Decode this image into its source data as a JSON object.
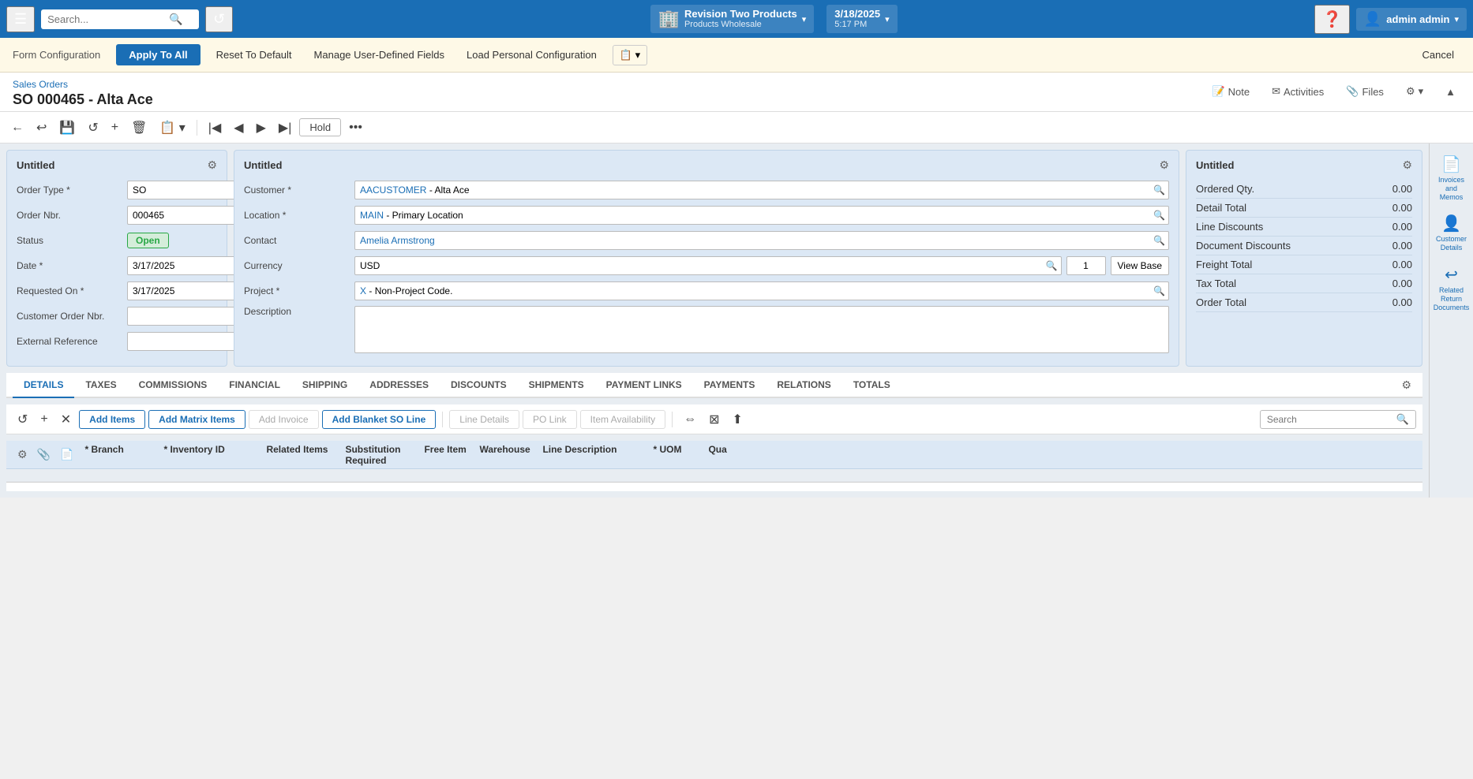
{
  "topNav": {
    "searchPlaceholder": "Search...",
    "company": {
      "name": "Revision Two Products",
      "sub": "Products Wholesale",
      "icon": "🏢"
    },
    "datetime": {
      "date": "3/18/2025",
      "time": "5:17 PM"
    },
    "user": {
      "name": "admin admin"
    }
  },
  "formConfig": {
    "label": "Form Configuration",
    "applyToAll": "Apply To All",
    "resetToDefault": "Reset To Default",
    "manageUserDefinedFields": "Manage User-Defined Fields",
    "loadPersonalConfiguration": "Load Personal Configuration",
    "cancel": "Cancel"
  },
  "pageHeader": {
    "breadcrumb": "Sales Orders",
    "title": "SO 000465 - Alta Ace",
    "actions": {
      "note": "Note",
      "activities": "Activities",
      "files": "Files"
    }
  },
  "toolbar": {
    "hold": "Hold"
  },
  "panels": {
    "left": {
      "title": "Untitled",
      "fields": {
        "orderType": {
          "label": "Order Type",
          "value": "SO"
        },
        "orderNbr": {
          "label": "Order Nbr.",
          "value": "000465"
        },
        "status": {
          "label": "Status",
          "value": "Open"
        },
        "date": {
          "label": "Date",
          "value": "3/17/2025"
        },
        "requestedOn": {
          "label": "Requested On",
          "value": "3/17/2025"
        },
        "customerOrderNbr": {
          "label": "Customer Order Nbr.",
          "value": ""
        },
        "externalReference": {
          "label": "External Reference",
          "value": ""
        }
      }
    },
    "mid": {
      "title": "Untitled",
      "fields": {
        "customer": {
          "label": "Customer",
          "value": "AACUSTOMER - Alta Ace",
          "linkPart": "AACUSTOMER",
          "rest": " - Alta Ace"
        },
        "location": {
          "label": "Location",
          "value": "MAIN - Primary Location",
          "linkPart": "MAIN",
          "rest": " - Primary Location"
        },
        "contact": {
          "label": "Contact",
          "value": "Amelia Armstrong"
        },
        "currency": {
          "label": "Currency",
          "value": "USD",
          "numValue": "1",
          "viewBase": "View Base"
        },
        "project": {
          "label": "Project",
          "value": "X - Non-Project Code.",
          "linkPart": "X",
          "rest": " - Non-Project Code."
        },
        "description": {
          "label": "Description",
          "value": ""
        }
      }
    },
    "right": {
      "title": "Untitled",
      "rows": [
        {
          "label": "Ordered Qty.",
          "value": "0.00"
        },
        {
          "label": "Detail Total",
          "value": "0.00"
        },
        {
          "label": "Line Discounts",
          "value": "0.00"
        },
        {
          "label": "Document Discounts",
          "value": "0.00"
        },
        {
          "label": "Freight Total",
          "value": "0.00"
        },
        {
          "label": "Tax Total",
          "value": "0.00"
        },
        {
          "label": "Order Total",
          "value": "0.00"
        }
      ]
    }
  },
  "tabs": [
    {
      "id": "details",
      "label": "DETAILS",
      "active": true
    },
    {
      "id": "taxes",
      "label": "TAXES",
      "active": false
    },
    {
      "id": "commissions",
      "label": "COMMISSIONS",
      "active": false
    },
    {
      "id": "financial",
      "label": "FINANCIAL",
      "active": false
    },
    {
      "id": "shipping",
      "label": "SHIPPING",
      "active": false
    },
    {
      "id": "addresses",
      "label": "ADDRESSES",
      "active": false
    },
    {
      "id": "discounts",
      "label": "DISCOUNTS",
      "active": false
    },
    {
      "id": "shipments",
      "label": "SHIPMENTS",
      "active": false
    },
    {
      "id": "paymentLinks",
      "label": "PAYMENT LINKS",
      "active": false
    },
    {
      "id": "payments",
      "label": "PAYMENTS",
      "active": false
    },
    {
      "id": "relations",
      "label": "RELATIONS",
      "active": false
    },
    {
      "id": "totals",
      "label": "TOTALS",
      "active": false
    }
  ],
  "detailToolbar": {
    "addItems": "Add Items",
    "addMatrixItems": "Add Matrix Items",
    "addInvoice": "Add Invoice",
    "addBlanketSOLine": "Add Blanket SO Line",
    "lineDetails": "Line Details",
    "poLink": "PO Link",
    "itemAvailability": "Item Availability",
    "search": "Search"
  },
  "tableColumns": [
    {
      "label": "* Branch"
    },
    {
      "label": "* Inventory ID"
    },
    {
      "label": "Related Items"
    },
    {
      "label": "Substitution Required"
    },
    {
      "label": "Free Item"
    },
    {
      "label": "Warehouse"
    },
    {
      "label": "Line Description"
    },
    {
      "label": "* UOM"
    },
    {
      "label": "Qua"
    }
  ],
  "rightPanel": {
    "invoicesAndMemos": {
      "label": "Invoices and\nMemos",
      "icon": "📄"
    },
    "customerDetails": {
      "label": "Customer\nDetails",
      "icon": "👤"
    },
    "relatedReturnDocuments": {
      "label": "Related\nReturn\nDocuments",
      "icon": "↩"
    }
  }
}
